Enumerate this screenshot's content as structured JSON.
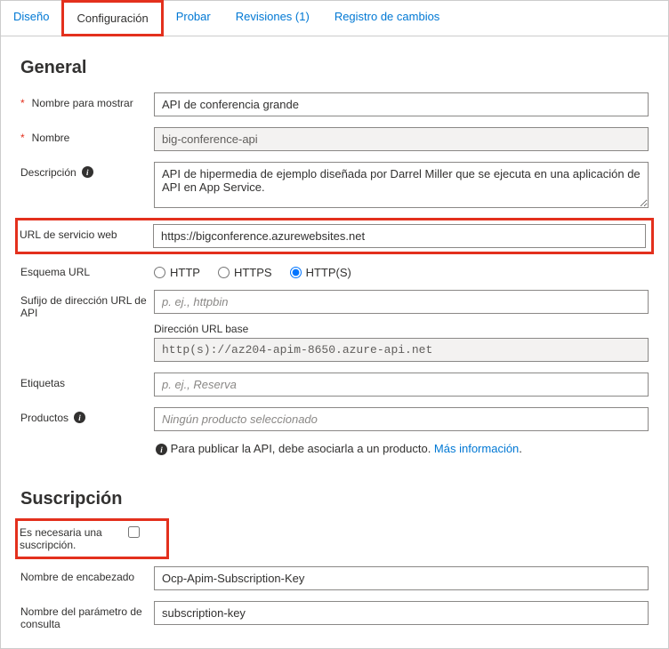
{
  "tabs": {
    "design": "Diseño",
    "config": "Configuración",
    "test": "Probar",
    "revisions": "Revisiones (1)",
    "changelog": "Registro de cambios"
  },
  "general": {
    "heading": "General",
    "displayName": {
      "label": "Nombre para mostrar",
      "value": "API de conferencia grande"
    },
    "name": {
      "label": "Nombre",
      "value": "big-conference-api"
    },
    "description": {
      "label": "Descripción",
      "value": "API de hipermedia de ejemplo diseñada por Darrel Miller que se ejecuta en una aplicación de API en App Service."
    },
    "webServiceUrl": {
      "label": "URL de servicio web",
      "value": "https://bigconference.azurewebsites.net"
    },
    "urlScheme": {
      "label": "Esquema URL",
      "options": {
        "http": "HTTP",
        "https": "HTTPS",
        "both": "HTTP(S)"
      }
    },
    "apiUrlSuffix": {
      "label": "Sufijo de dirección URL de API",
      "placeholder": "p. ej., httpbin"
    },
    "baseUrl": {
      "label": "Dirección URL base",
      "value": "http(s)://az204-apim-8650.azure-api.net"
    },
    "tags": {
      "label": "Etiquetas",
      "placeholder": "p. ej., Reserva"
    },
    "products": {
      "label": "Productos",
      "placeholder": "Ningún producto seleccionado",
      "hint": "Para publicar la API, debe asociarla a un producto. ",
      "hintLink": "Más información"
    }
  },
  "subscription": {
    "heading": "Suscripción",
    "required": {
      "label": "Es necesaria una suscripción."
    },
    "headerName": {
      "label": "Nombre de encabezado",
      "value": "Ocp-Apim-Subscription-Key"
    },
    "queryParam": {
      "label": "Nombre del parámetro de consulta",
      "value": "subscription-key"
    }
  }
}
